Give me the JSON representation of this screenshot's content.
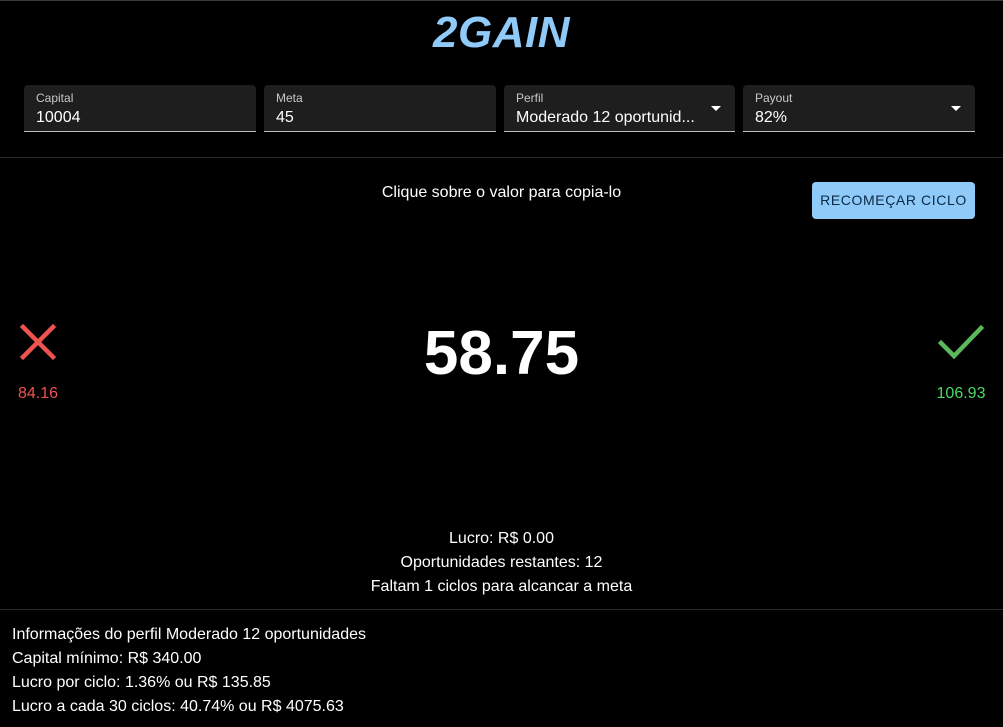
{
  "app": {
    "brand": "2GAIN"
  },
  "form": {
    "capital": {
      "label": "Capital",
      "value": "10004"
    },
    "meta": {
      "label": "Meta",
      "value": "45"
    },
    "perfil": {
      "label": "Perfil",
      "value": "Moderado 12 oportunid..."
    },
    "payout": {
      "label": "Payout",
      "value": "82%"
    }
  },
  "cycle": {
    "hint": "Clique sobre o valor para copia-lo",
    "restart_label": "RECOMEÇAR CICLO",
    "current_value": "58.75",
    "loss_value": "84.16",
    "win_value": "106.93",
    "loss_icon": "close-icon",
    "win_icon": "check-icon"
  },
  "stats": {
    "lucro": "Lucro: R$ 0.00",
    "oportunidades": "Oportunidades restantes: 12",
    "faltam": "Faltam 1 ciclos para alcancar a meta"
  },
  "profile_info": {
    "title": "Informações do perfil Moderado 12 oportunidades",
    "capital_minimo": "Capital mínimo: R$ 340.00",
    "lucro_ciclo": "Lucro por ciclo: 1.36% ou R$ 135.85",
    "lucro_30": "Lucro a cada 30 ciclos: 40.74% ou R$ 4075.63"
  },
  "colors": {
    "accent": "#90caf9",
    "loss": "#ef5350",
    "win": "#4cd964",
    "win_icon": "#5cb85c"
  }
}
